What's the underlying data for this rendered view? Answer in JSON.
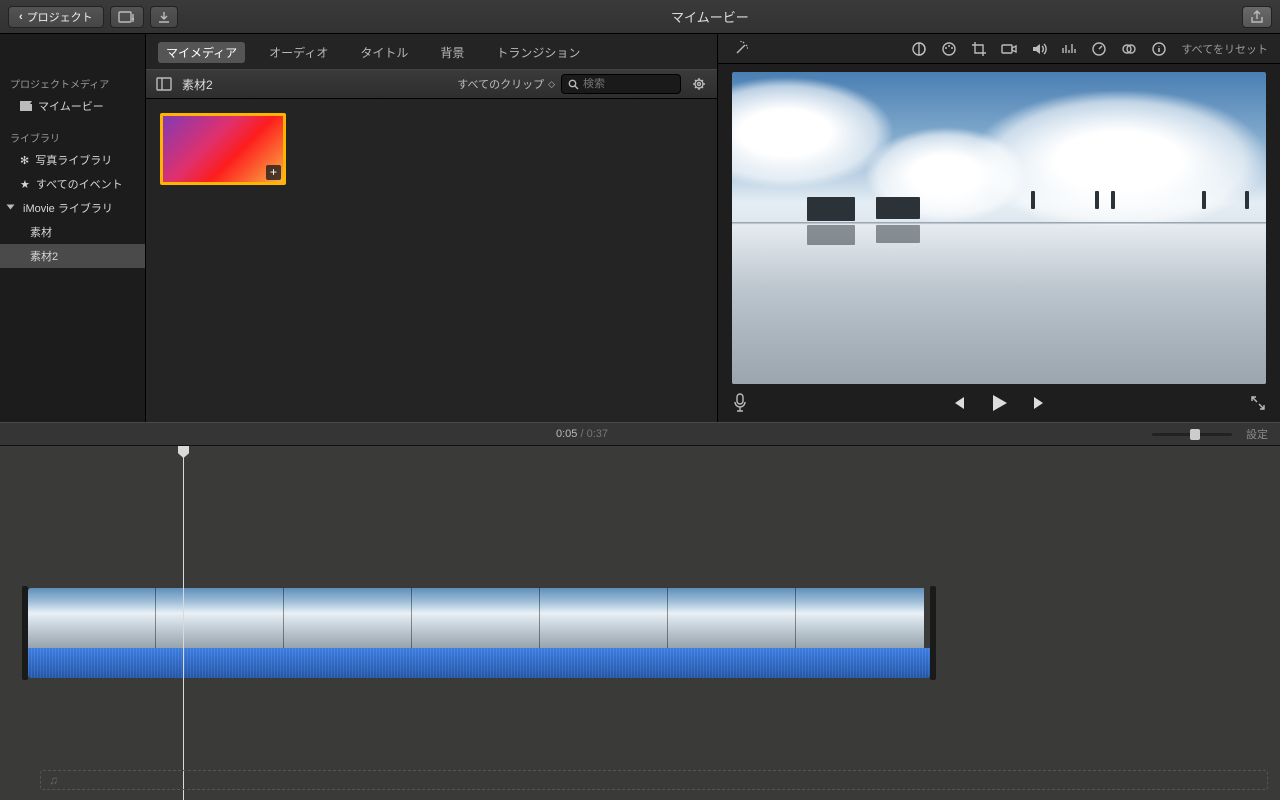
{
  "titlebar": {
    "back_label": "プロジェクト",
    "title": "マイムービー"
  },
  "tabs": {
    "my_media": "マイメディア",
    "audio": "オーディオ",
    "titles": "タイトル",
    "backgrounds": "背景",
    "transitions": "トランジション"
  },
  "sidebar": {
    "project_media_hdr": "プロジェクトメディア",
    "my_movie": "マイムービー",
    "library_hdr": "ライブラリ",
    "photo_library": "写真ライブラリ",
    "all_events": "すべてのイベント",
    "imovie_library": "iMovie ライブラリ",
    "sozai": "素材",
    "sozai2": "素材2"
  },
  "browser": {
    "title": "素材2",
    "filter_label": "すべてのクリップ",
    "search_placeholder": "検索"
  },
  "adjust": {
    "reset": "すべてをリセット"
  },
  "playback": {
    "current": "0:05",
    "sep": " / ",
    "duration": "0:37",
    "settings": "設定"
  },
  "icons": {
    "back_chevron": "‹",
    "share": "share-icon",
    "grid": "grid-icon",
    "download": "download-icon"
  }
}
